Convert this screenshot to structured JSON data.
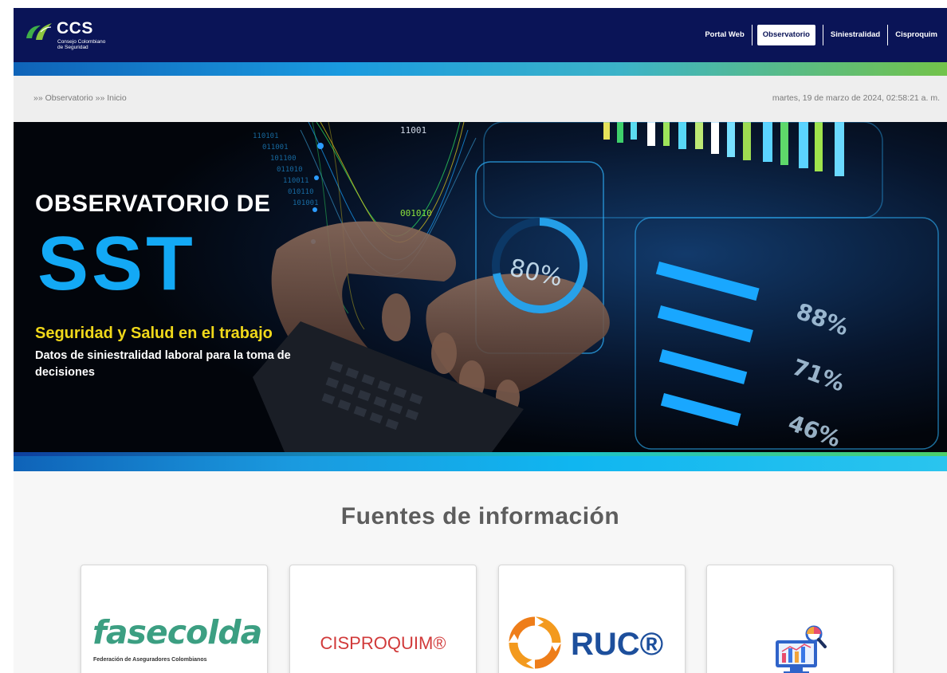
{
  "header": {
    "logo_name": "CCS",
    "logo_subtitle_line1": "Consejo Colombiano",
    "logo_subtitle_line2": "de Seguridad",
    "nav_items": [
      {
        "label": "Portal Web",
        "active": false
      },
      {
        "label": "Observatorio",
        "active": true
      },
      {
        "label": "Siniestralidad",
        "active": false
      },
      {
        "label": "Cisproquim",
        "active": false
      }
    ]
  },
  "breadcrumb": {
    "text": "»» Observatorio »» Inicio",
    "datetime": "martes, 19 de marzo de 2024, 02:58:21 a. m."
  },
  "hero": {
    "title": "OBSERVATORIO DE",
    "big": "SST",
    "subtitle": "Seguridad y Salud en el trabajo",
    "description": "Datos de siniestralidad laboral para la toma de decisiones",
    "overlay_texts": [
      "80%",
      "88%",
      "71%",
      "46%",
      "001010",
      "11001"
    ]
  },
  "sources": {
    "title": "Fuentes de información",
    "cards": [
      {
        "name": "fasecolda",
        "logo_text": "fasecolda",
        "logo_sub": "Federación de Aseguradores Colombianos"
      },
      {
        "name": "cisproquim",
        "logo_text": "CISPROQUIM®"
      },
      {
        "name": "ruc",
        "logo_text": "RUC®",
        "icon": "recycle-arrows-icon"
      },
      {
        "name": "statistics",
        "icon": "data-analysis-icon"
      }
    ]
  },
  "colors": {
    "navbar": "#0a1457",
    "accent_blue": "#13a9f5",
    "accent_yellow": "#f0d81a",
    "fasecolda_green": "#3c9f82",
    "cisproquim_red": "#d13a3a",
    "ruc_blue": "#1d4f9c",
    "ruc_orange": "#f39a1e"
  }
}
